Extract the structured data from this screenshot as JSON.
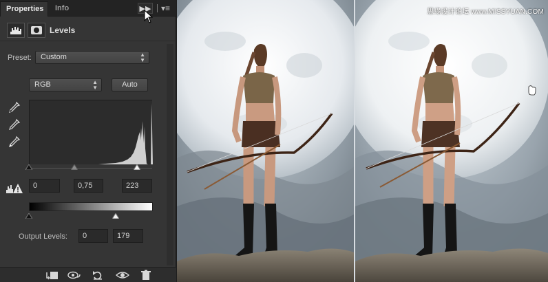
{
  "tabs": [
    {
      "label": "Properties",
      "active": true
    },
    {
      "label": "Info",
      "active": false
    }
  ],
  "panel": {
    "title": "Levels",
    "preset_label": "Preset:",
    "preset_value": "Custom",
    "channel_value": "RGB",
    "auto_label": "Auto",
    "input_levels": {
      "black": "0",
      "midtone": "0,75",
      "white": "223"
    },
    "output_label": "Output Levels:",
    "output_levels": {
      "black": "0",
      "white": "179"
    }
  },
  "histogram": {
    "input_black": 0,
    "input_midtone": 0.75,
    "input_white": 223,
    "output_black": 0,
    "output_white": 179,
    "max": 255
  },
  "icons": {
    "collapse": "double-chevron-right-icon",
    "panel_menu": "panel-menu-icon",
    "adjustment": "levels-histogram-icon",
    "mask": "layer-mask-icon",
    "footer": [
      "clip-to-layer-icon",
      "view-previous-state-icon",
      "reset-icon",
      "toggle-visibility-icon",
      "delete-icon"
    ]
  },
  "watermark": "思缘设计论坛 www.MISSYUAN.COM",
  "colors": {
    "panel_bg": "#353535",
    "sky": "#9aa5ae",
    "moon": "#f2f4f6"
  }
}
